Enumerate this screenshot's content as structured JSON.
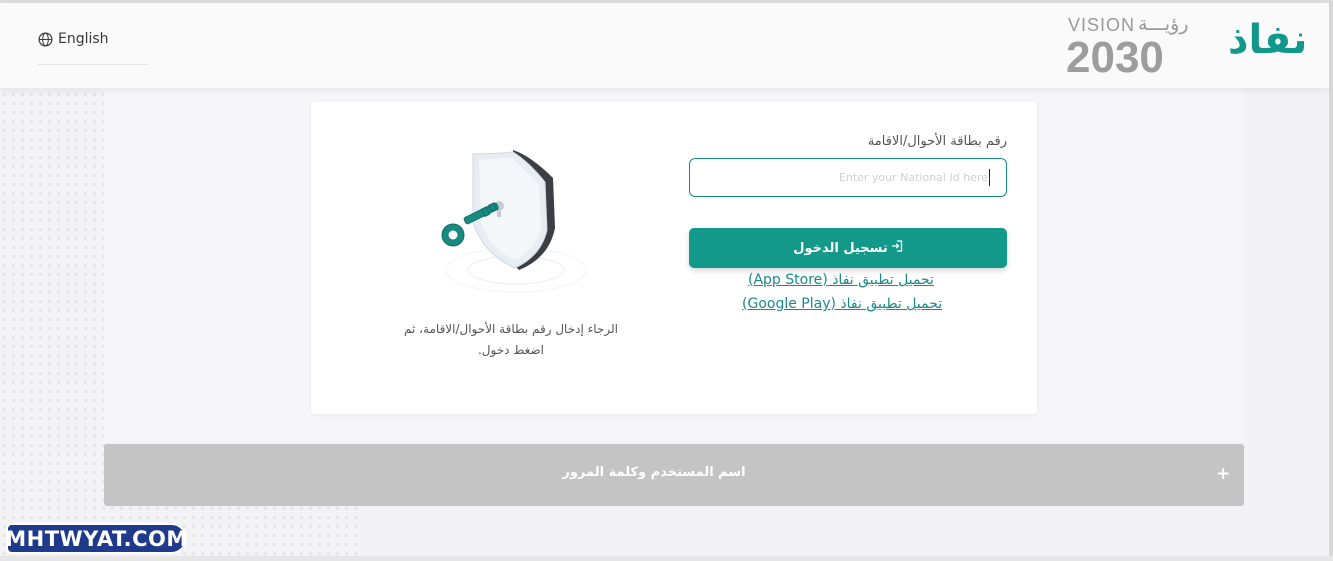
{
  "header": {
    "language_label": "English",
    "vision_label": "VISION",
    "vision_arabic": "رؤيـــة",
    "vision_year": "2030",
    "brand_name": "نفاذ"
  },
  "login": {
    "id_label": "رقم بطاقة الأحوال/الاقامة",
    "id_placeholder": "Enter your National Id here",
    "login_button": "تسجيل الدخول",
    "app_store_link": "تحميل تطبيق نفاذ (App Store)",
    "google_play_link": "تحميل تطبيق نفاذ (Google Play)",
    "hint_text": "الرجاء إدخال رقم بطاقة الأحوال/الاقامة، ثم اضغط دخول."
  },
  "accordion": {
    "title": "اسم المستخدم وكلمة المرور",
    "toggle": "+"
  },
  "watermark": {
    "text": "MHTWYAT.COM"
  },
  "colors": {
    "primary": "#13998a",
    "accordion_bg": "#c4c4c4",
    "link": "#1a8b86"
  }
}
